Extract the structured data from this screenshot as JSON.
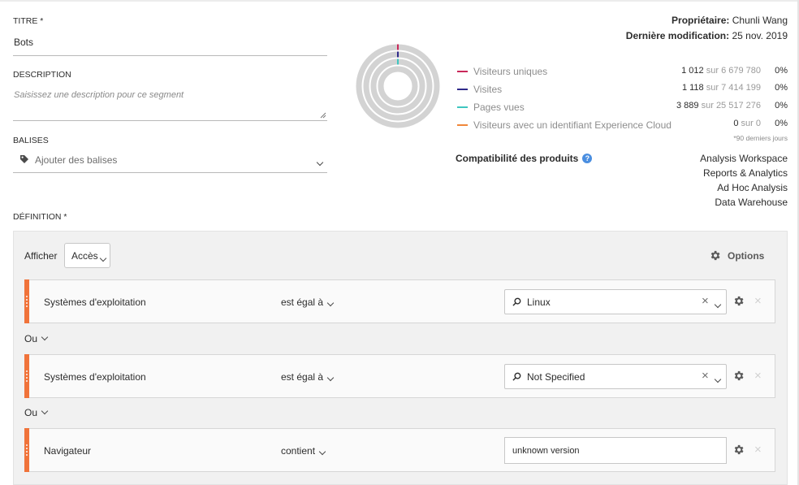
{
  "form": {
    "title_label": "TITRE *",
    "title_value": "Bots",
    "description_label": "DESCRIPTION",
    "description_placeholder": "Saisissez une description pour ce segment",
    "tags_label": "BALISES",
    "tags_placeholder": "Ajouter des balises",
    "definition_label": "DÉFINITION *"
  },
  "meta": {
    "owner_label": "Propriétaire:",
    "owner_value": "Chunli Wang",
    "modified_label": "Dernière modification:",
    "modified_value": "25 nov. 2019"
  },
  "stats": {
    "rows": [
      {
        "label": "Visiteurs uniques",
        "value": "1 012",
        "of_text": "sur",
        "total": "6 679 780",
        "pct": "0%",
        "color": "#c9285a"
      },
      {
        "label": "Visites",
        "value": "1 118",
        "of_text": "sur",
        "total": "7 414 199",
        "pct": "0%",
        "color": "#2f2a8a"
      },
      {
        "label": "Pages vues",
        "value": "3 889",
        "of_text": "sur",
        "total": "25 517 276",
        "pct": "0%",
        "color": "#3ec6c0"
      },
      {
        "label": "Visiteurs avec un identifiant Experience Cloud",
        "value": "0",
        "of_text": "sur",
        "total": "0",
        "pct": "0%",
        "color": "#f0873a"
      }
    ],
    "footnote": "*90 derniers jours",
    "donut_fractions": [
      0.0002,
      0.0002,
      0.0002,
      0
    ]
  },
  "compat": {
    "label": "Compatibilité des produits",
    "help_icon": "help-icon",
    "products": [
      "Analysis Workspace",
      "Reports & Analytics",
      "Ad Hoc Analysis",
      "Data Warehouse"
    ]
  },
  "definition": {
    "show_label": "Afficher",
    "show_value": "Accès",
    "options_label": "Options",
    "or_label": "Ou",
    "rules": [
      {
        "dimension": "Systèmes d'exploitation",
        "operator": "est égal à",
        "value": "Linux"
      },
      {
        "dimension": "Systèmes d'exploitation",
        "operator": "est égal à",
        "value": "Not Specified"
      },
      {
        "dimension": "Navigateur",
        "operator": "contient",
        "value": "unknown version"
      }
    ]
  }
}
